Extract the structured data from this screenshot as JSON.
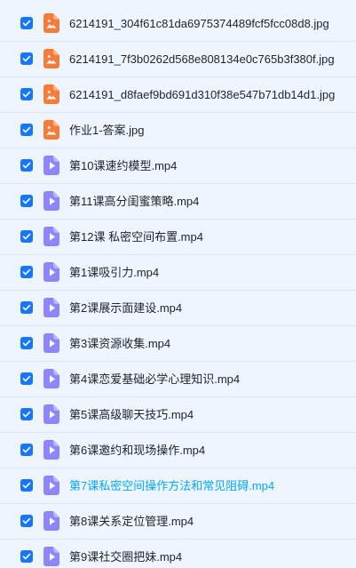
{
  "colors": {
    "background": "#eef5fe",
    "checkbox_checked": "#1677ff",
    "image_icon": "#f57c3a",
    "video_icon": "#8f86ff",
    "highlight_text": "#06a7ff"
  },
  "files": [
    {
      "name": "6214191_304f61c81da6975374489fcf5fcc08d8.jpg",
      "icon": "image-file-icon",
      "checked": true,
      "highlighted": false
    },
    {
      "name": "6214191_7f3b0262d568e808134e0c765b3f380f.jpg",
      "icon": "image-file-icon",
      "checked": true,
      "highlighted": false
    },
    {
      "name": "6214191_d8faef9bd691d310f38e547b71db14d1.jpg",
      "icon": "image-file-icon",
      "checked": true,
      "highlighted": false
    },
    {
      "name": "作业1-答案.jpg",
      "icon": "image-file-icon",
      "checked": true,
      "highlighted": false
    },
    {
      "name": "第10课速约模型.mp4",
      "icon": "video-file-icon",
      "checked": true,
      "highlighted": false
    },
    {
      "name": "第11课高分闺蜜策略.mp4",
      "icon": "video-file-icon",
      "checked": true,
      "highlighted": false
    },
    {
      "name": "第12课 私密空间布置.mp4",
      "icon": "video-file-icon",
      "checked": true,
      "highlighted": false
    },
    {
      "name": "第1课吸引力.mp4",
      "icon": "video-file-icon",
      "checked": true,
      "highlighted": false
    },
    {
      "name": "第2课展示面建设.mp4",
      "icon": "video-file-icon",
      "checked": true,
      "highlighted": false
    },
    {
      "name": "第3课资源收集.mp4",
      "icon": "video-file-icon",
      "checked": true,
      "highlighted": false
    },
    {
      "name": "第4课恋爱基础必学心理知识.mp4",
      "icon": "video-file-icon",
      "checked": true,
      "highlighted": false
    },
    {
      "name": "第5课高级聊天技巧.mp4",
      "icon": "video-file-icon",
      "checked": true,
      "highlighted": false
    },
    {
      "name": "第6课邀约和现场操作.mp4",
      "icon": "video-file-icon",
      "checked": true,
      "highlighted": false
    },
    {
      "name": "第7课私密空间操作方法和常见阻碍.mp4",
      "icon": "video-file-icon",
      "checked": true,
      "highlighted": true
    },
    {
      "name": "第8课关系定位管理.mp4",
      "icon": "video-file-icon",
      "checked": true,
      "highlighted": false
    },
    {
      "name": "第9课社交圈把妹.mp4",
      "icon": "video-file-icon",
      "checked": true,
      "highlighted": false
    }
  ]
}
